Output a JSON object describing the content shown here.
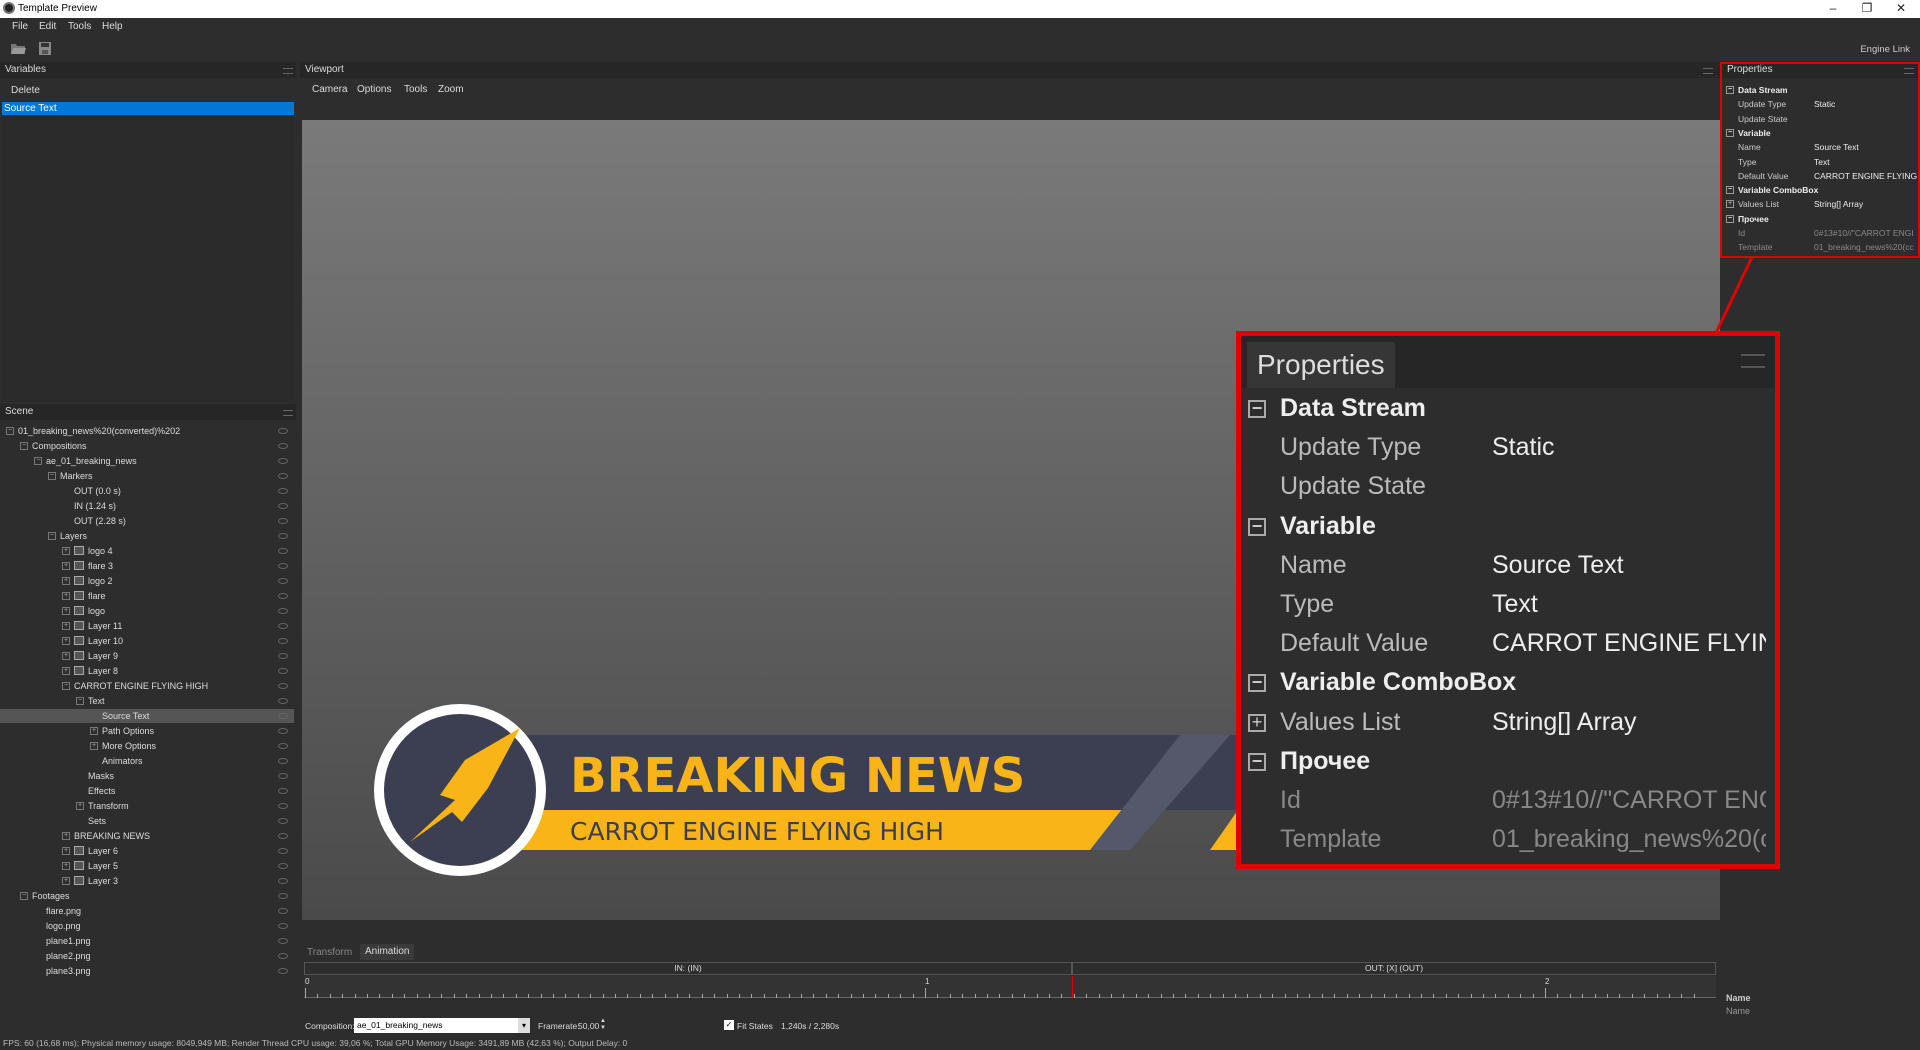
{
  "window": {
    "title": "Template Preview",
    "minimize": "–",
    "maximize": "❐",
    "close": "✕"
  },
  "menu": [
    "File",
    "Edit",
    "Tools",
    "Help"
  ],
  "toolbar": {
    "engine_link": "Engine Link"
  },
  "variables": {
    "title": "Variables",
    "delete": "Delete",
    "items": [
      "Source Text"
    ]
  },
  "scene": {
    "title": "Scene",
    "tree": [
      {
        "label": "01_breaking_news%20(converted)%202",
        "level": 0,
        "exp": "-"
      },
      {
        "label": "Compositions",
        "level": 1,
        "exp": "-"
      },
      {
        "label": "ae_01_breaking_news",
        "level": 2,
        "exp": "-"
      },
      {
        "label": "Markers",
        "level": 3,
        "exp": "-"
      },
      {
        "label": "OUT (0.0 s)",
        "level": 4
      },
      {
        "label": "IN (1.24 s)",
        "level": 4
      },
      {
        "label": "OUT (2.28 s)",
        "level": 4
      },
      {
        "label": "Layers",
        "level": 3,
        "exp": "-"
      },
      {
        "label": "logo 4",
        "level": 4,
        "exp": "+",
        "img": true
      },
      {
        "label": "flare 3",
        "level": 4,
        "exp": "+",
        "img": true
      },
      {
        "label": "logo 2",
        "level": 4,
        "exp": "+",
        "img": true
      },
      {
        "label": "flare",
        "level": 4,
        "exp": "+",
        "img": true
      },
      {
        "label": "logo",
        "level": 4,
        "exp": "+",
        "img": true
      },
      {
        "label": "Layer 11",
        "level": 4,
        "exp": "+",
        "img": true
      },
      {
        "label": "Layer 10",
        "level": 4,
        "exp": "+",
        "img": true
      },
      {
        "label": "Layer 9",
        "level": 4,
        "exp": "+",
        "img": true
      },
      {
        "label": "Layer 8",
        "level": 4,
        "exp": "+",
        "img": true
      },
      {
        "label": "CARROT ENGINE FLYING HIGH",
        "level": 4,
        "exp": "-"
      },
      {
        "label": "Text",
        "level": 5,
        "exp": "-"
      },
      {
        "label": "Source Text",
        "level": 6,
        "sel": true
      },
      {
        "label": "Path Options",
        "level": 6,
        "exp": "+"
      },
      {
        "label": "More Options",
        "level": 6,
        "exp": "+"
      },
      {
        "label": "Animators",
        "level": 6
      },
      {
        "label": "Masks",
        "level": 5
      },
      {
        "label": "Effects",
        "level": 5
      },
      {
        "label": "Transform",
        "level": 5,
        "exp": "+"
      },
      {
        "label": "Sets",
        "level": 5
      },
      {
        "label": "BREAKING NEWS",
        "level": 4,
        "exp": "+"
      },
      {
        "label": "Layer 6",
        "level": 4,
        "exp": "+",
        "img": true
      },
      {
        "label": "Layer 5",
        "level": 4,
        "exp": "+",
        "img": true
      },
      {
        "label": "Layer 3",
        "level": 4,
        "exp": "+",
        "img": true
      },
      {
        "label": "Footages",
        "level": 1,
        "exp": "-"
      },
      {
        "label": "flare.png",
        "level": 2
      },
      {
        "label": "logo.png",
        "level": 2
      },
      {
        "label": "plane1.png",
        "level": 2
      },
      {
        "label": "plane2.png",
        "level": 2
      },
      {
        "label": "plane3.png",
        "level": 2
      }
    ]
  },
  "viewport": {
    "title": "Viewport",
    "menu": [
      "Camera",
      "Options",
      "Tools",
      "Zoom"
    ],
    "graphic": {
      "headline": "BREAKING NEWS",
      "subline": "CARROT ENGINE FLYING HIGH"
    }
  },
  "properties": {
    "title": "Properties",
    "rows": [
      {
        "cat": true,
        "box": "−",
        "key": "Data Stream"
      },
      {
        "key": "Update Type",
        "value": "Static"
      },
      {
        "key": "Update State",
        "value": ""
      },
      {
        "cat": true,
        "box": "−",
        "key": "Variable"
      },
      {
        "key": "Name",
        "value": "Source Text"
      },
      {
        "key": "Type",
        "value": "Text"
      },
      {
        "key": "Default Value",
        "value": "CARROT ENGINE FLYING"
      },
      {
        "cat": true,
        "box": "−",
        "key": "Variable ComboBox"
      },
      {
        "box": "+",
        "key": "Values List",
        "value": "String[] Array"
      },
      {
        "cat": true,
        "box": "−",
        "key": "Прочее"
      },
      {
        "dim": true,
        "key": "Id",
        "value": "0#13#10//\"CARROT ENGI"
      },
      {
        "dim": true,
        "key": "Template",
        "value": "01_breaking_news%20(cc"
      }
    ],
    "footer_name": "Name",
    "footer_desc": "Name"
  },
  "timeline": {
    "tabs": [
      "Transform",
      "Animation"
    ],
    "in_label": "IN: (IN)",
    "out_label": "OUT: [X] (OUT)",
    "ticks": [
      "0",
      "1",
      "2"
    ],
    "composition_label": "Composition:",
    "composition_value": "ae_01_breaking_news",
    "framerate_label": "Framerate:",
    "framerate_value": "50,00",
    "fit_states_label": "Fit States",
    "time": "1,240s / 2,280s"
  },
  "status": "FPS: 60 (16,68 ms); Physical memory usage: 8049,949 MB; Render Thread CPU usage: 39,06 %; Total GPU Memory Usage: 3491,89 MB (42,63 %); Output Delay: 0",
  "colors": {
    "selection": "#0078d7",
    "highlight_red": "#e00000",
    "news_navy": "#3c3e51",
    "news_orange": "#f9b417"
  }
}
